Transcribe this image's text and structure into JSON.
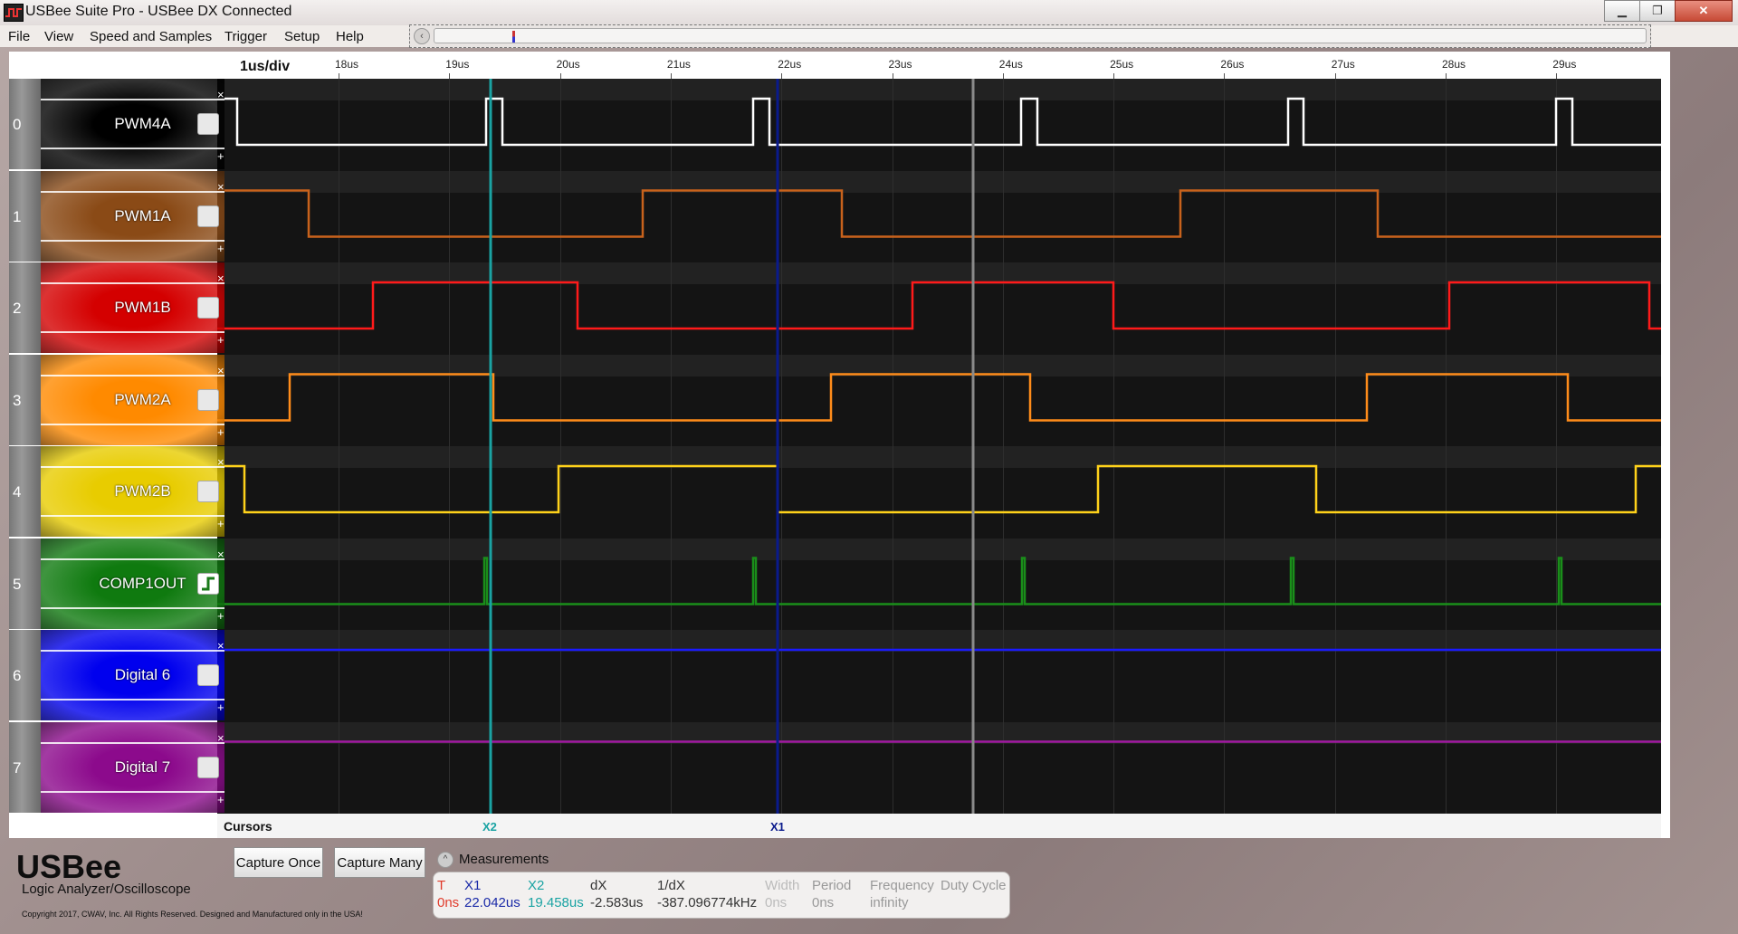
{
  "window": {
    "title": "USBee Suite Pro - USBee DX Connected",
    "minimize": "▁",
    "maximize": "❐",
    "close": "✕"
  },
  "menu": [
    "File",
    "View",
    "Speed and Samples",
    "Trigger",
    "Setup",
    "Help"
  ],
  "nav": {
    "back": "<<<",
    "forward": ">>>"
  },
  "overview_arrow": "‹",
  "timebase": {
    "div_label": "1us/div",
    "ticks": [
      "18us",
      "19us",
      "20us",
      "21us",
      "22us",
      "23us",
      "24us",
      "25us",
      "26us",
      "27us",
      "28us",
      "29us"
    ]
  },
  "channels": [
    {
      "num": "0",
      "name": "PWM4A",
      "color": "#ffffff",
      "bg": "#000000",
      "trigger": false
    },
    {
      "num": "1",
      "name": "PWM1A",
      "color": "#c8621c",
      "bg": "#8a4a16",
      "trigger": false
    },
    {
      "num": "2",
      "name": "PWM1B",
      "color": "#ff1a1a",
      "bg": "#d40000",
      "trigger": false
    },
    {
      "num": "3",
      "name": "PWM2A",
      "color": "#ff8c1a",
      "bg": "#ff8a00",
      "trigger": false
    },
    {
      "num": "4",
      "name": "PWM2B",
      "color": "#ffd21a",
      "bg": "#e8cc00",
      "trigger": false
    },
    {
      "num": "5",
      "name": "COMP1OUT",
      "color": "#1a8f1a",
      "bg": "#0f7a0f",
      "trigger": true
    },
    {
      "num": "6",
      "name": "Digital 6",
      "color": "#1a1aff",
      "bg": "#0000ee",
      "trigger": false
    },
    {
      "num": "7",
      "name": "Digital 7",
      "color": "#a01aa0",
      "bg": "#8c0a8c",
      "trigger": false
    }
  ],
  "channel_buttons": {
    "remove": "×",
    "add": "+"
  },
  "cursors": {
    "label": "Cursors",
    "x2": {
      "label": "X2",
      "color": "#1aa3a3"
    },
    "x1": {
      "label": "X1",
      "color": "#0a1a8c"
    },
    "trigger_color": "#8a8a8a"
  },
  "buttons": {
    "capture_once": "Capture Once",
    "capture_many": "Capture Many"
  },
  "measurements": {
    "toggle": "^",
    "title": "Measurements",
    "columns": [
      {
        "header": "T",
        "value": "0ns",
        "color": "#e03a2a"
      },
      {
        "header": "X1",
        "value": "22.042us",
        "color": "#1a2aa8"
      },
      {
        "header": "X2",
        "value": "19.458us",
        "color": "#1aa3a3"
      },
      {
        "header": "dX",
        "value": "-2.583us",
        "color": "#333333"
      },
      {
        "header": "1/dX",
        "value": "-387.096774kHz",
        "color": "#333333"
      },
      {
        "header": "Width",
        "value": "0ns",
        "color": "#bbbbbb"
      },
      {
        "header": "Period",
        "value": "0ns",
        "color": "#999999"
      },
      {
        "header": "Frequency",
        "value": "infinity",
        "color": "#999999"
      },
      {
        "header": "Duty Cycle",
        "value": "",
        "color": "#999999"
      }
    ]
  },
  "brand": {
    "logo": "USBee",
    "subtitle": "Logic Analyzer/Oscilloscope",
    "copyright": "Copyright 2017, CWAV, Inc. All Rights Reserved. Designed and Manufactured only in the USA!"
  }
}
